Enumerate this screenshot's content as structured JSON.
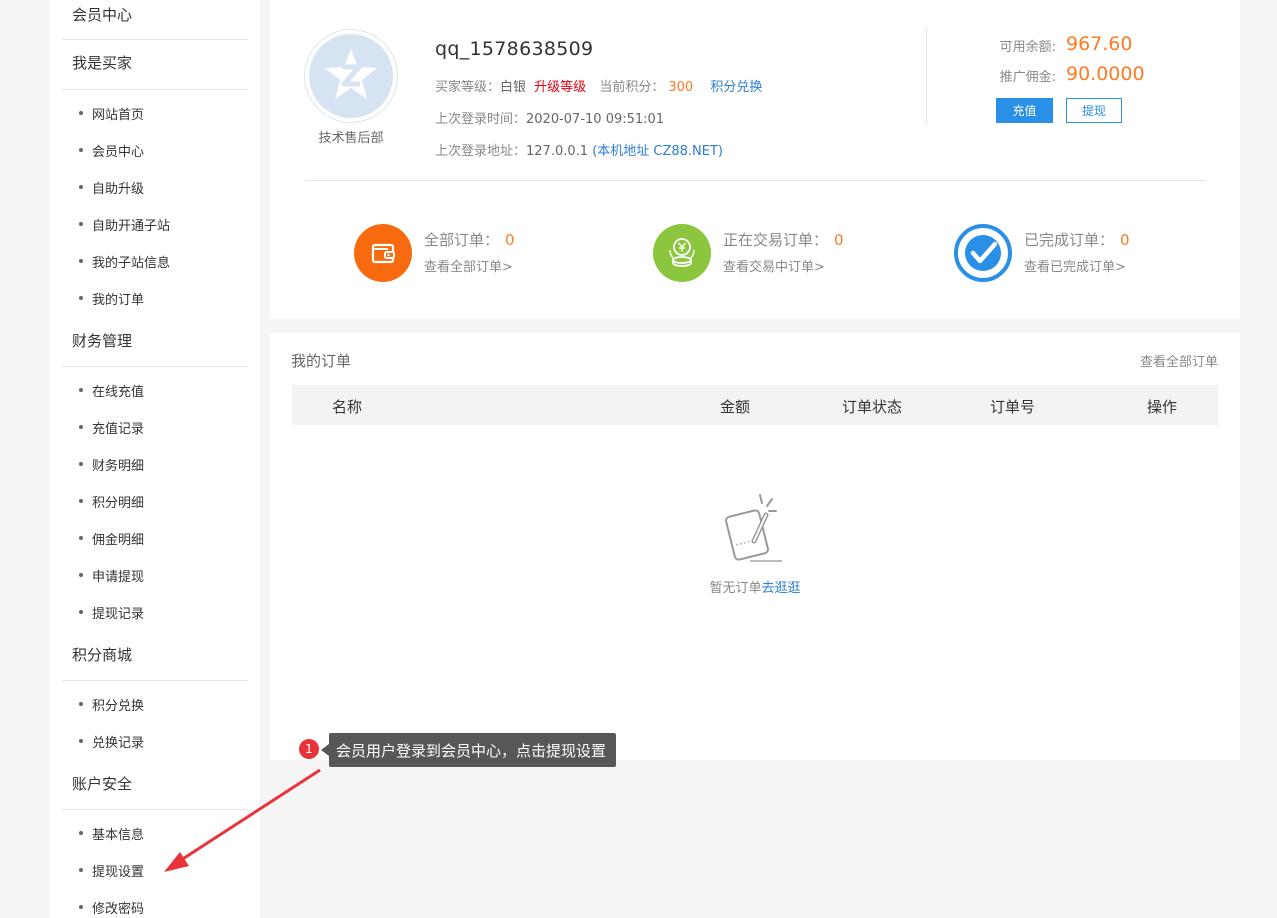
{
  "sidebar": {
    "sections": [
      {
        "title": "会员中心"
      },
      {
        "title": "我是买家",
        "items": [
          "网站首页",
          "会员中心",
          "自助升级",
          "自助开通子站",
          "我的子站信息",
          "我的订单"
        ]
      },
      {
        "title": "财务管理",
        "items": [
          "在线充值",
          "充值记录",
          "财务明细",
          "积分明细",
          "佣金明细",
          "申请提现",
          "提现记录"
        ]
      },
      {
        "title": "积分商城",
        "items": [
          "积分兑换",
          "兑换记录"
        ]
      },
      {
        "title": "账户安全",
        "items": [
          "基本信息",
          "提现设置",
          "修改密码"
        ]
      }
    ]
  },
  "profile": {
    "avatar_caption": "技术售后部",
    "username": "qq_1578638509",
    "level_label": "买家等级：",
    "level_value": "白银",
    "upgrade_link": "升级等级",
    "points_label": "当前积分：",
    "points_value": "300",
    "points_link": "积分兑换",
    "last_login_time_label": "上次登录时间：",
    "last_login_time": "2020-07-10 09:51:01",
    "last_login_addr_label": "上次登录地址：",
    "last_login_addr": "127.0.0.1",
    "last_login_addr_note": "(本机地址 CZ88.NET)"
  },
  "balance": {
    "available_label": "可用余额:",
    "available_value": "967.60",
    "commission_label": "推广佣金:",
    "commission_value": "90.0000",
    "recharge_button": "充值",
    "withdraw_button": "提现"
  },
  "stats": [
    {
      "title": "全部订单：",
      "count": "0",
      "link": "查看全部订单>",
      "icon": "wallet-icon",
      "color": "#f76a0e"
    },
    {
      "title": "正在交易订单：",
      "count": "0",
      "link": "查看交易中订单>",
      "icon": "yen-coin-icon",
      "color": "#8cc63e"
    },
    {
      "title": "已完成订单：",
      "count": "0",
      "link": "查看已完成订单>",
      "icon": "check-circle-icon",
      "color": "#2a8fe6"
    }
  ],
  "orders": {
    "title": "我的订单",
    "view_all": "查看全部订单",
    "columns": [
      "名称",
      "金额",
      "订单状态",
      "订单号",
      "操作"
    ],
    "empty_text": "暂无订单",
    "empty_link": "去逛逛"
  },
  "annotation": {
    "badge": "1",
    "text": "会员用户登录到会员中心，点击提现设置"
  }
}
